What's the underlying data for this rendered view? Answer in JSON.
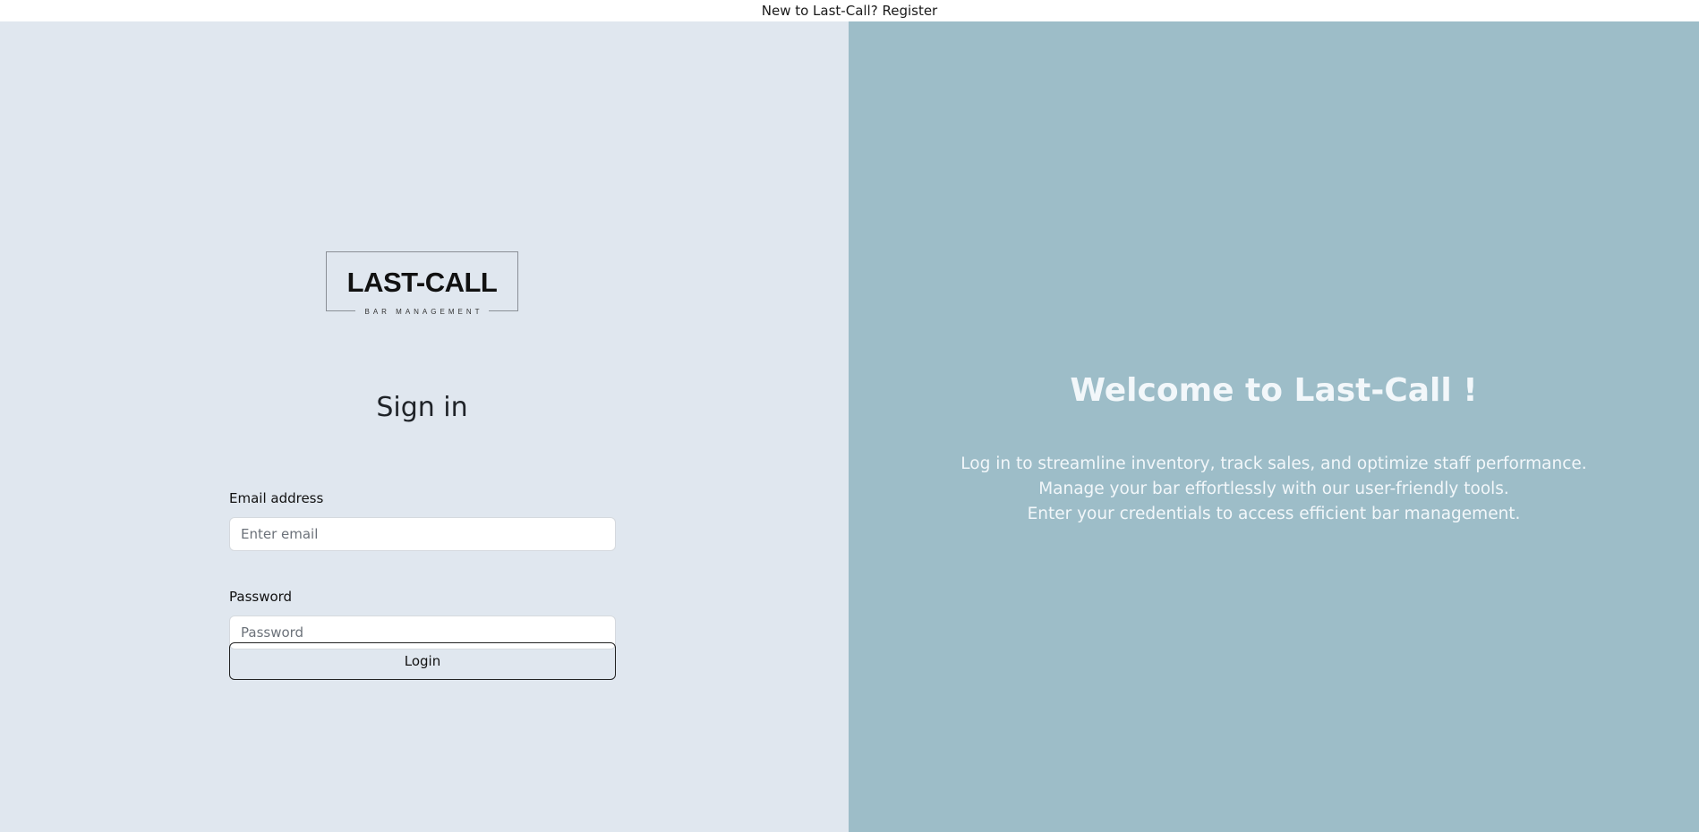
{
  "topbar": {
    "prompt": "New to Last-Call?",
    "register_link": "Register"
  },
  "logo": {
    "main": "LAST-CALL",
    "sub": "BAR MANAGEMENT"
  },
  "signin": {
    "title": "Sign in",
    "email_label": "Email address",
    "email_placeholder": "Enter email",
    "password_label": "Password",
    "password_placeholder": "Password",
    "login_button": "Login"
  },
  "welcome": {
    "title": "Welcome to Last-Call !",
    "lines": [
      "Log in to streamline inventory, track sales, and optimize staff performance.",
      "Manage your bar effortlessly with our user-friendly tools.",
      "Enter your credentials to access efficient bar management."
    ]
  },
  "colors": {
    "left_panel": "#e0e7ef",
    "right_panel": "#9dbdc8",
    "welcome_text": "#f2f7fa"
  }
}
